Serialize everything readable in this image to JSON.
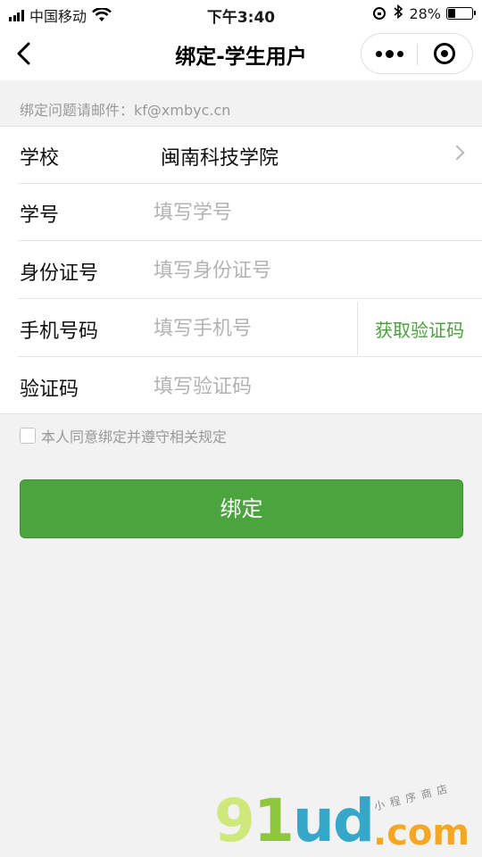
{
  "status_bar": {
    "carrier": "中国移动",
    "time": "下午3:40",
    "battery_text": "28%",
    "battery_level": 0.28
  },
  "nav": {
    "title": "绑定-学生用户"
  },
  "hint": "绑定问题请邮件：kf@xmbyc.cn",
  "form": {
    "school": {
      "label": "学校",
      "value": "闽南科技学院"
    },
    "student_id": {
      "label": "学号",
      "placeholder": "填写学号"
    },
    "id_card": {
      "label": "身份证号",
      "placeholder": "填写身份证号"
    },
    "phone": {
      "label": "手机号码",
      "placeholder": "填写手机号",
      "get_code_label": "获取验证码"
    },
    "code": {
      "label": "验证码",
      "placeholder": "填写验证码"
    }
  },
  "agreement": {
    "text": "本人同意绑定并遵守相关规定",
    "checked": false
  },
  "bind_button": {
    "label": "绑定"
  },
  "watermark": {
    "brand": "91ud",
    "domain": ".com",
    "tagline": "小程序商店"
  },
  "colors": {
    "accent_green": "#4ba43d",
    "link_green": "#4aa23c",
    "background": "#f2f2f2"
  }
}
